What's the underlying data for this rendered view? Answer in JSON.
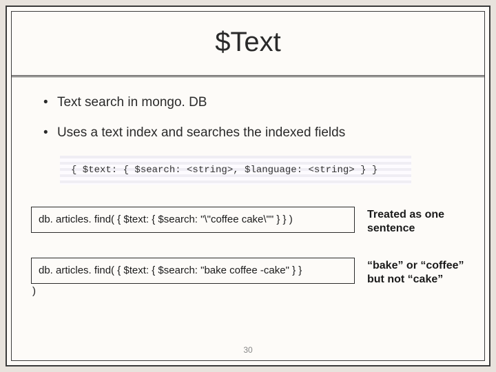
{
  "title": "$Text",
  "bullets": {
    "b1": "Text search in mongo. DB",
    "b2": "Uses a text index and searches the indexed fields"
  },
  "syntax": "{ $text: { $search: <string>, $language: <string> } }",
  "example1": {
    "code": "db. articles. find( { $text: { $search: \"\\\"coffee cake\\\"\" } } )",
    "note": "Treated as one sentence"
  },
  "example2": {
    "code": "db. articles. find( { $text: { $search: \"bake coffee -cake\" } }",
    "closing": ")",
    "note": "“bake” or “coffee” but not “cake”"
  },
  "pageNumber": "30"
}
